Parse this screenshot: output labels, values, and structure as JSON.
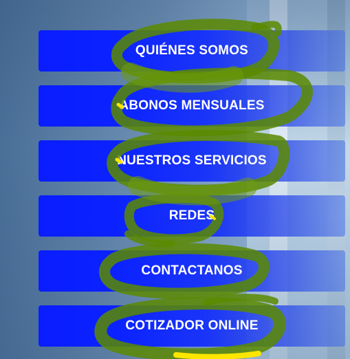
{
  "menu": {
    "items": [
      {
        "label": "QUIÉNES SOMOS"
      },
      {
        "label": "ABONOS MENSUALES"
      },
      {
        "label": "NUESTROS SERVICIOS"
      },
      {
        "label": "REDES"
      },
      {
        "label": "CONTACTANOS"
      },
      {
        "label": "COTIZADOR ONLINE"
      }
    ]
  },
  "colors": {
    "button_blue": "#0b22ff",
    "scribble_green": "#5a8a00",
    "scribble_yellow": "#ffe600",
    "label_white": "#ffffff"
  }
}
